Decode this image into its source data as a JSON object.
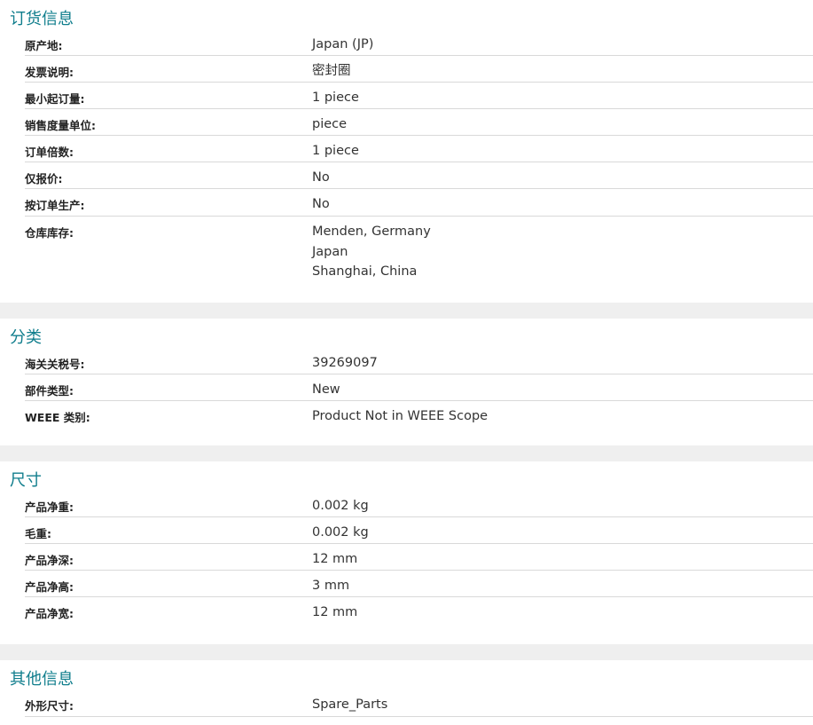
{
  "sections": [
    {
      "title": "订货信息",
      "rows": [
        {
          "label": "原产地:",
          "value": "Japan (JP)"
        },
        {
          "label": "发票说明:",
          "value": "密封圈"
        },
        {
          "label": "最小起订量:",
          "value": "1 piece"
        },
        {
          "label": "销售度量单位:",
          "value": "piece"
        },
        {
          "label": "订单倍数:",
          "value": "1 piece"
        },
        {
          "label": "仅报价:",
          "value": "No"
        },
        {
          "label": "按订单生产:",
          "value": "No"
        },
        {
          "label": "仓库库存:",
          "values": [
            "Menden, Germany",
            "Japan",
            "Shanghai, China"
          ]
        }
      ]
    },
    {
      "title": "分类",
      "rows": [
        {
          "label": "海关关税号:",
          "value": "39269097"
        },
        {
          "label": "部件类型:",
          "value": "New"
        },
        {
          "label": "WEEE 类别:",
          "value": "Product Not in WEEE Scope"
        }
      ]
    },
    {
      "title": "尺寸",
      "rows": [
        {
          "label": "产品净重:",
          "value": "0.002 kg"
        },
        {
          "label": "毛重:",
          "value": "0.002 kg"
        },
        {
          "label": "产品净深:",
          "value": "12 mm"
        },
        {
          "label": "产品净高:",
          "value": "3 mm"
        },
        {
          "label": "产品净宽:",
          "value": "12 mm"
        }
      ]
    },
    {
      "title": "其他信息",
      "rows": [
        {
          "label": "外形尺寸:",
          "value": "Spare_Parts"
        }
      ]
    }
  ],
  "colors": {
    "section_title": "#0f7d8c",
    "separator_band": "#efefef",
    "row_border": "#d9d9d9"
  }
}
